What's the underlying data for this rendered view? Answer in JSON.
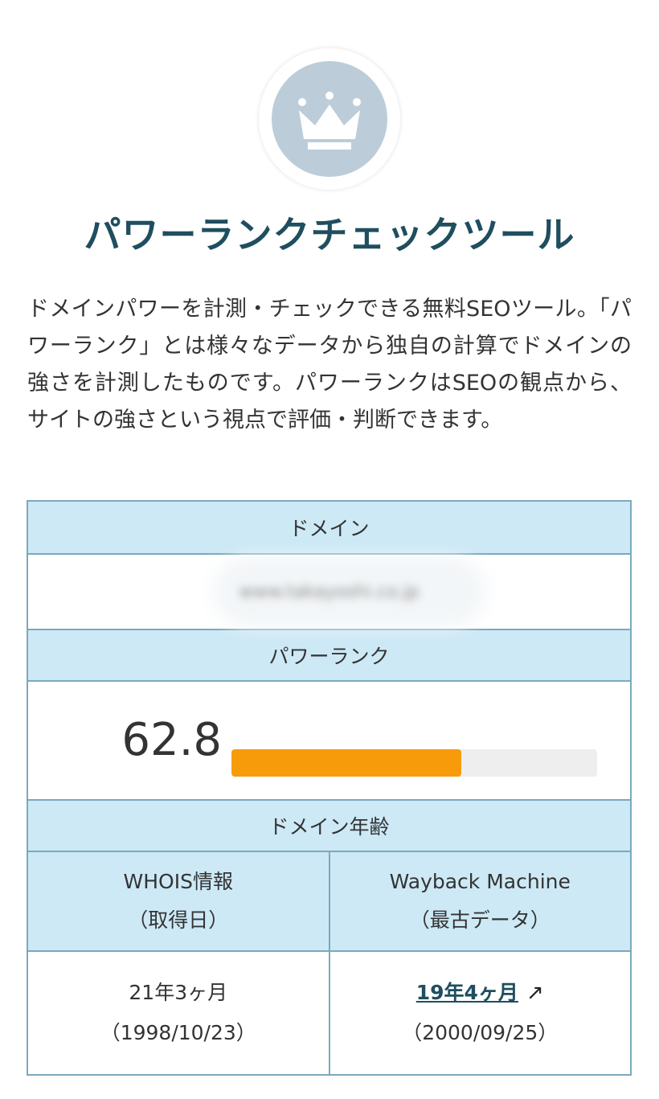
{
  "title": "パワーランクチェックツール",
  "description": "ドメインパワーを計測・チェックできる無料SEOツール。「パワーランク」とは様々なデータから独自の計算でドメインの強さを計測したものです。パワーランクはSEOの観点から、サイトの強さという視点で評価・判断できます。",
  "table": {
    "domain_header": "ドメイン",
    "domain_value": "www.takayoshi.co.jp",
    "power_rank_header": "パワーランク",
    "power_rank_value": "62.8",
    "power_rank_fraction": 0.628,
    "domain_age_header": "ドメイン年齢",
    "whois_header_line1": "WHOIS情報",
    "whois_header_line2": "（取得日）",
    "wayback_header_line1": "Wayback Machine",
    "wayback_header_line2": "（最古データ）",
    "whois_age": "21年3ヶ月",
    "whois_date": "（1998/10/23）",
    "wayback_age": "19年4ヶ月",
    "wayback_date": "（2000/09/25）",
    "wayback_link_icon": "external-link-arrow-icon"
  },
  "colors": {
    "accent": "#1f4e5f",
    "header_bg": "#cde9f6",
    "border": "#7aa9bd",
    "bar": "#f89b0a",
    "logo_bg": "#bccdd9"
  }
}
